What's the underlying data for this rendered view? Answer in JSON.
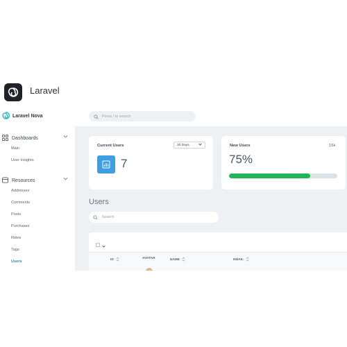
{
  "app": {
    "title": "Laravel"
  },
  "nova": {
    "brand": "Laravel Nova",
    "search_placeholder": "Press / to search"
  },
  "sidebar": {
    "dashboards": {
      "label": "Dashboards",
      "items": [
        "Main",
        "User Insights"
      ]
    },
    "resources": {
      "label": "Resources",
      "items": [
        "Addresses",
        "Comments",
        "Posts",
        "Purchases",
        "Roles",
        "Tags",
        "Users"
      ],
      "active": "Users"
    }
  },
  "metrics": {
    "current_users": {
      "title": "Current Users",
      "range": "30 Days",
      "value": "7"
    },
    "new_users": {
      "title": "New Users",
      "total": "15k",
      "percent_label": "75%",
      "progress_fraction": 0.75
    }
  },
  "resource": {
    "title": "Users",
    "search_placeholder": "Search",
    "columns": [
      "ID",
      "AVATAR",
      "NAME",
      "EMAIL"
    ]
  },
  "colors": {
    "accent": "#2b88c8",
    "success": "#21b45a",
    "icon_bg": "#3d9fdf"
  }
}
